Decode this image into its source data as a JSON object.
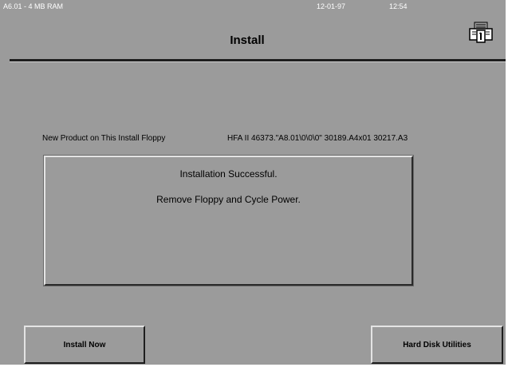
{
  "header": {
    "version": "A6.01 - 4 MB RAM",
    "date": "12-01-97",
    "time": "12:54",
    "title": "Install"
  },
  "product": {
    "label": "New Product on This Install Floppy",
    "value": "HFA II 46373.\"A8.01\\0\\0\\0\" 30189.A4x01 30217.A3"
  },
  "message": {
    "line1": "Installation Successful.",
    "line2": "Remove Floppy and Cycle Power."
  },
  "buttons": {
    "install_now": "Install Now",
    "hard_disk_utilities": "Hard Disk Utilities"
  },
  "icons": {
    "top_right": "printer-icon"
  }
}
